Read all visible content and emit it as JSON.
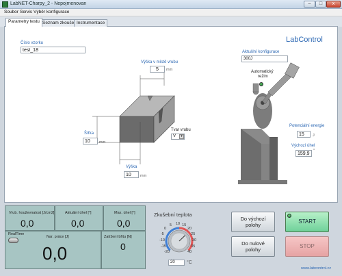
{
  "window": {
    "title": "LabNET-Charpy_2  -  Nepojmenovan",
    "buttons": {
      "minimize": "–",
      "maximize": "□",
      "close": "x"
    }
  },
  "menu": [
    "Soubor",
    "Servis",
    "Výběr konfigurace"
  ],
  "tabs": [
    {
      "label": "Parametry testu",
      "active": true
    },
    {
      "label": "Seznam zkoušek",
      "active": false
    },
    {
      "label": "Instrumentace",
      "active": false
    }
  ],
  "brand": "LabControl",
  "sample": {
    "label": "Číslo vzorku",
    "value": "test_18"
  },
  "specimen": {
    "notch_height_label": "Výška v místě vrubu",
    "notch_height_value": "5",
    "notch_height_unit": "mm",
    "width_label": "Šířka",
    "width_value": "10",
    "width_unit": "mm",
    "height_label": "Výška",
    "height_value": "10",
    "height_unit": "mm",
    "notch_shape_label": "Tvar vrubu",
    "notch_shape_value": "V"
  },
  "configuration": {
    "label": "Aktuální konfigurace",
    "value": "300J"
  },
  "auto_mode": {
    "label_line1": "Automatický",
    "label_line2": "režim"
  },
  "potential_energy": {
    "label": "Potenciální energie",
    "value": "15",
    "unit": "J"
  },
  "start_angle": {
    "label": "Výchozí úhel",
    "value": "159,9",
    "unit": "°"
  },
  "results": {
    "toughness": {
      "label": "Vrub. houževnatost [J/cm2]",
      "value": "0,0"
    },
    "current_angle": {
      "label": "Aktuální úhel [°]",
      "value": "0,0"
    },
    "max_angle": {
      "label": "Max. úhel [°]",
      "value": "0,0"
    },
    "work": {
      "label": "Nar. práce [J]",
      "value": "0,0"
    },
    "load": {
      "label": "Zatížení břitu [N]",
      "value": "0"
    },
    "realtime_label": "RealTime"
  },
  "temperature": {
    "title": "Zkušební teplota",
    "ticks": [
      "-20",
      "-15",
      "-10",
      "-5",
      "0",
      "5",
      "10",
      "15",
      "20",
      "25",
      "30",
      "35",
      "40"
    ],
    "value": "20",
    "unit": "°C",
    "knob_level": 0.67
  },
  "buttons": {
    "home_line1": "Do výchozí",
    "home_line2": "polohy",
    "zero_line1": "Do nulové",
    "zero_line2": "polohy",
    "start": "START",
    "stop": "STOP"
  },
  "website": "www.labcontrol.cz",
  "colors": {
    "accent": "#2b67b3",
    "results_panel": "#a7c5c3",
    "start": "#6fd19a",
    "stop": "#e6a3a3"
  }
}
